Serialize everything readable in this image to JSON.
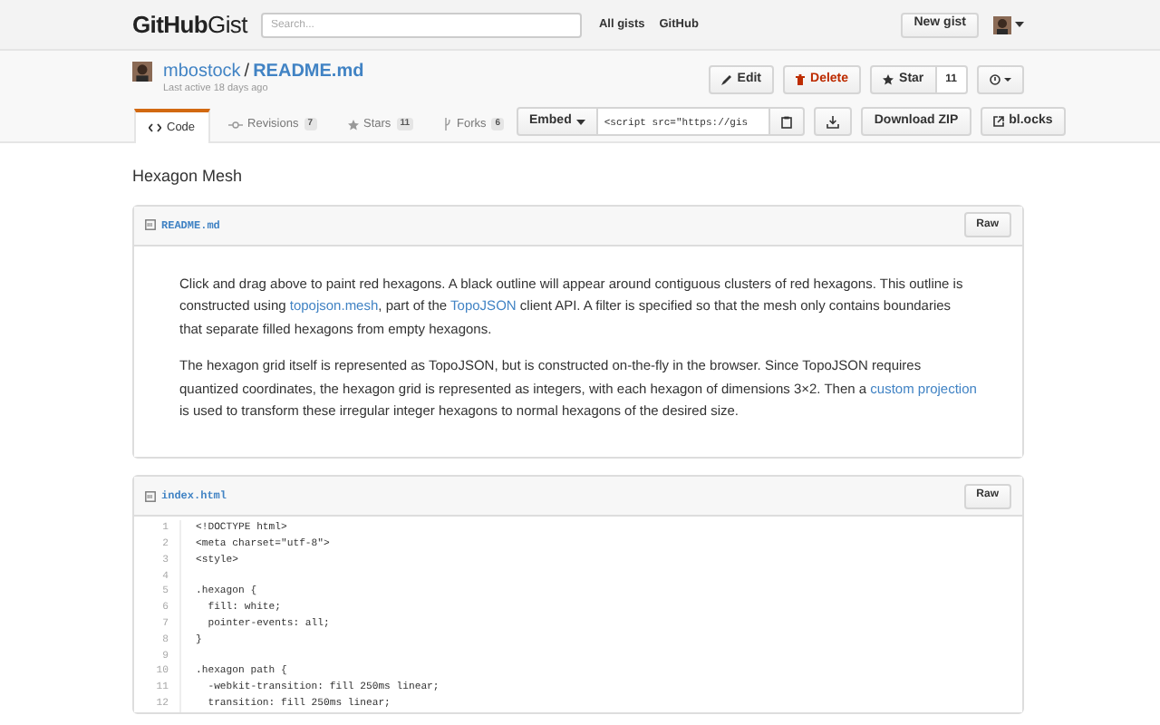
{
  "header": {
    "logo_bold": "GitHub",
    "logo_light": "Gist",
    "search": {
      "placeholder": "Search..."
    },
    "links": [
      "All gists",
      "GitHub"
    ],
    "new_gist": "New gist"
  },
  "gist": {
    "owner": "mbostock",
    "separator": "/",
    "name": "README.md",
    "last_active": "Last active 18 days ago",
    "actions": [
      {
        "kind": "edit",
        "label": "Edit"
      },
      {
        "kind": "delete",
        "label": "Delete"
      },
      {
        "kind": "star",
        "label": "Star",
        "count": "11"
      },
      {
        "kind": "options"
      }
    ]
  },
  "tabs": [
    {
      "kind": "code",
      "label": "Code",
      "selected": true
    },
    {
      "kind": "revisions",
      "label": "Revisions",
      "count": "7",
      "selected": false
    },
    {
      "kind": "stars",
      "label": "Stars",
      "count": "11",
      "selected": false
    },
    {
      "kind": "forks",
      "label": "Forks",
      "count": "6",
      "selected": false
    }
  ],
  "embed": {
    "label": "Embed",
    "value": "<script src=\"https://gis"
  },
  "download_zip": "Download ZIP",
  "blocks": "bl.ocks",
  "description": "Hexagon Mesh",
  "files": [
    {
      "kind": "markdown",
      "name": "README.md",
      "raw": "Raw",
      "paragraphs": [
        [
          {
            "text": "Click and drag above to paint red hexagons. A black outline will appear around contiguous clusters of red hexagons. This outline is constructed using "
          },
          {
            "text": "topojson.mesh",
            "link": true
          },
          {
            "text": ", part of the "
          },
          {
            "text": "TopoJSON",
            "link": true
          },
          {
            "text": " client API. A filter is specified so that the mesh only contains boundaries that separate filled hexagons from empty hexagons."
          }
        ],
        [
          {
            "text": "The hexagon grid itself is represented as TopoJSON, but is constructed on-the-fly in the browser. Since TopoJSON requires quantized coordinates, the hexagon grid is represented as integers, with each hexagon of dimensions 3×2. Then a "
          },
          {
            "text": "custom projection",
            "link": true
          },
          {
            "text": " is used to transform these irregular integer hexagons to normal hexagons of the desired size."
          }
        ]
      ]
    },
    {
      "kind": "code",
      "name": "index.html",
      "raw": "Raw",
      "lines": [
        {
          "number": "1",
          "text": "<!DOCTYPE html>"
        },
        {
          "number": "2",
          "text": "<meta charset=\"utf-8\">"
        },
        {
          "number": "3",
          "text": "<style>"
        },
        {
          "number": "4"
        },
        {
          "number": "5",
          "text": ".hexagon {"
        },
        {
          "number": "6",
          "text": "  fill: white;"
        },
        {
          "number": "7",
          "text": "  pointer-events: all;"
        },
        {
          "number": "8",
          "text": "}"
        },
        {
          "number": "9"
        },
        {
          "number": "10",
          "text": ".hexagon path {"
        },
        {
          "number": "11",
          "text": "  -webkit-transition: fill 250ms linear;"
        },
        {
          "number": "12",
          "text": "  transition: fill 250ms linear;"
        }
      ]
    }
  ]
}
